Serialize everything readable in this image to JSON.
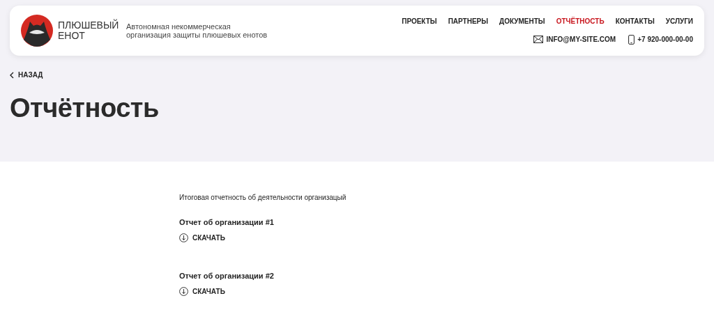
{
  "header": {
    "brand": "ПЛЮШЕВЫЙ ЕНОТ",
    "tagline": "Автономная некоммерческая организация защиты плюшевых енотов",
    "nav": [
      {
        "label": "ПРОЕКТЫ",
        "selected": false
      },
      {
        "label": "ПАРТНЕРЫ",
        "selected": false
      },
      {
        "label": "ДОКУМЕНТЫ",
        "selected": false
      },
      {
        "label": "ОТЧЁТНОСТЬ",
        "selected": true
      },
      {
        "label": "КОНТАКТЫ",
        "selected": false
      },
      {
        "label": "УСЛУГИ",
        "selected": false
      }
    ],
    "contacts": [
      {
        "kind": "email",
        "text": "INFO@MY-SITE.COM"
      },
      {
        "kind": "phone",
        "text": "+7 920-000-00-00"
      }
    ]
  },
  "back_link": "НАЗАД",
  "page_title": "Отчётность",
  "intro": "Итоговая отчетность об деятельности организацый",
  "reports": [
    {
      "title": "Отчет об организации #1",
      "download": "СКАЧАТЬ"
    },
    {
      "title": "Отчет об организации #2",
      "download": "СКАЧАТЬ"
    }
  ]
}
